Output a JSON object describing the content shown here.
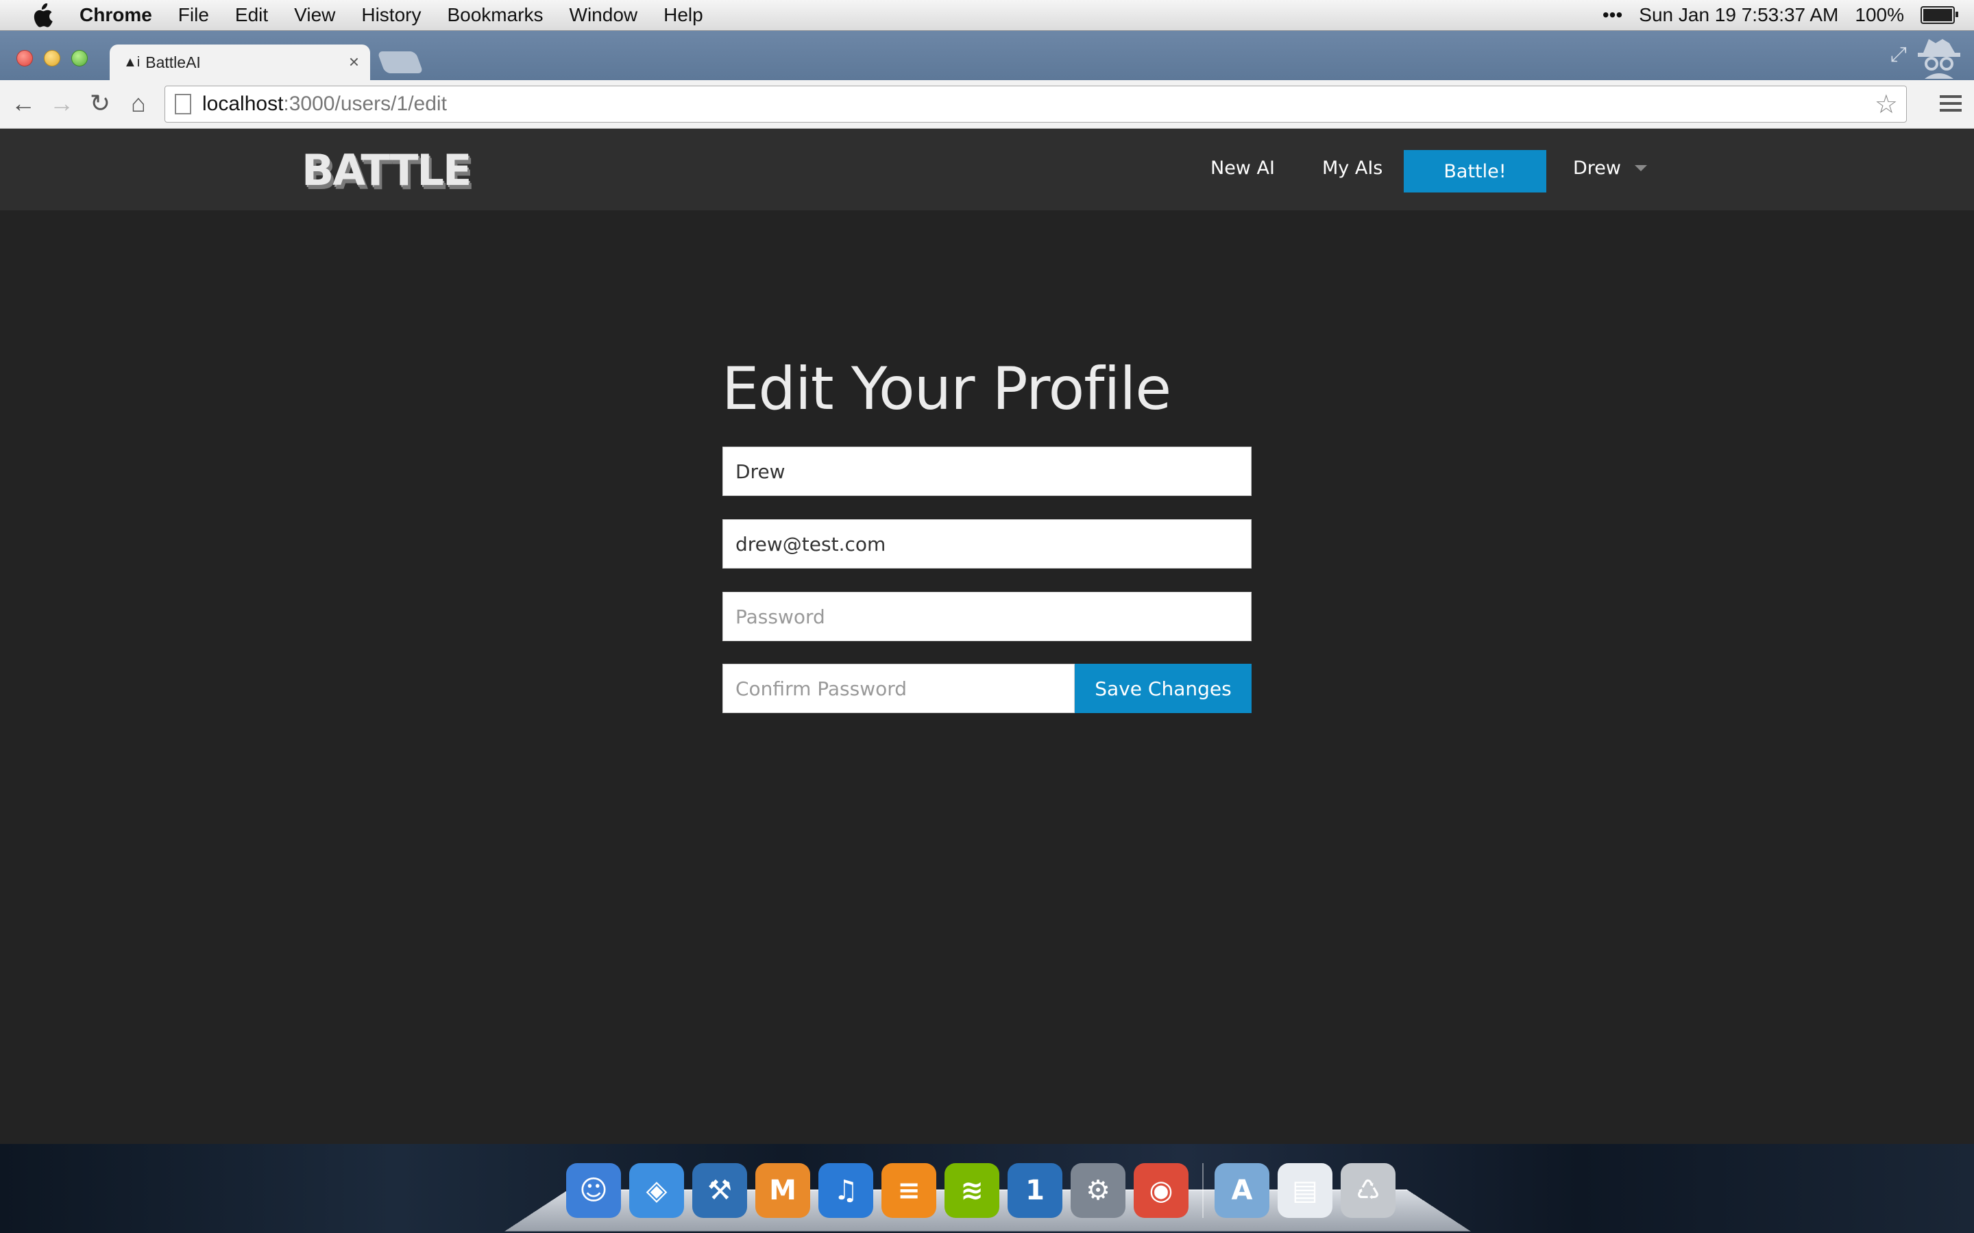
{
  "menubar": {
    "app": "Chrome",
    "items": [
      "File",
      "Edit",
      "View",
      "History",
      "Bookmarks",
      "Window",
      "Help"
    ],
    "extras": "•••",
    "clock": "Sun Jan 19  7:53:37 AM",
    "battery": "100%"
  },
  "browser": {
    "tab_title": "BattleAI",
    "tab_favicon": "▲i",
    "url_host": "localhost",
    "url_path": ":3000/users/1/edit"
  },
  "site": {
    "logo": "BATTLE",
    "nav": {
      "new_ai": "New AI",
      "my_ais": "My AIs",
      "battle": "Battle!",
      "user": "Drew"
    }
  },
  "form": {
    "title": "Edit Your Profile",
    "name_value": "Drew",
    "email_value": "drew@test.com",
    "password_placeholder": "Password",
    "confirm_placeholder": "Confirm Password",
    "submit_label": "Save Changes"
  },
  "colors": {
    "accent": "#0c8bc7",
    "page_bg": "#232323",
    "nav_bg": "#2f2f2f"
  },
  "dock": {
    "apps": [
      {
        "name": "Finder",
        "icon": "finder-icon",
        "color": "#3d7fd8",
        "glyph": "☺"
      },
      {
        "name": "Safari",
        "icon": "safari-icon",
        "color": "#3d8fe0",
        "glyph": "◈"
      },
      {
        "name": "Xcode",
        "icon": "xcode-icon",
        "color": "#2f6fb3",
        "glyph": "⚒"
      },
      {
        "name": "Mou",
        "icon": "markdown-editor-icon",
        "color": "#e98a2a",
        "glyph": "M"
      },
      {
        "name": "iTunes",
        "icon": "itunes-icon",
        "color": "#2a7ad6",
        "glyph": "♫"
      },
      {
        "name": "iBooks",
        "icon": "ibooks-icon",
        "color": "#f08a1c",
        "glyph": "≡"
      },
      {
        "name": "Spotify",
        "icon": "spotify-icon",
        "color": "#7ab800",
        "glyph": "≋"
      },
      {
        "name": "1Password",
        "icon": "password-manager-icon",
        "color": "#2a6fb8",
        "glyph": "1"
      },
      {
        "name": "System Preferences",
        "icon": "system-preferences-icon",
        "color": "#7d8692",
        "glyph": "⚙"
      },
      {
        "name": "Chrome",
        "icon": "chrome-icon",
        "color": "#dd4b39",
        "glyph": "◉"
      }
    ],
    "stacks": [
      {
        "name": "Applications",
        "icon": "applications-folder-icon",
        "color": "#7aa9d6",
        "glyph": "A"
      },
      {
        "name": "Documents",
        "icon": "documents-stack-icon",
        "color": "#e8ecf1",
        "glyph": "▤"
      },
      {
        "name": "Trash",
        "icon": "trash-icon",
        "color": "#c4c8cd",
        "glyph": "♺"
      }
    ]
  }
}
